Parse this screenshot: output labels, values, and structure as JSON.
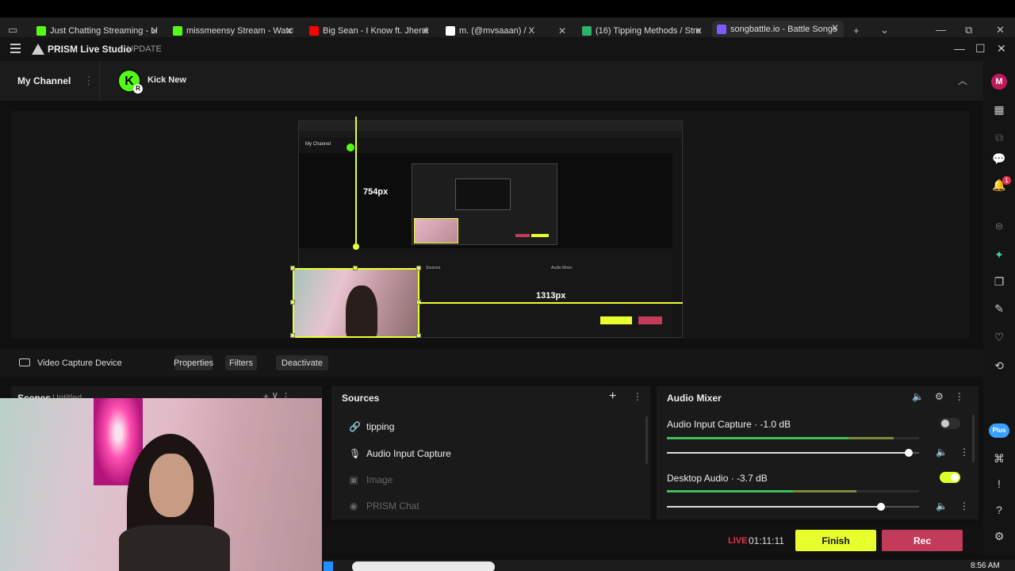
{
  "browser": {
    "tabs": [
      {
        "title": "Just Chatting Streaming - Li",
        "color": "#53fc18"
      },
      {
        "title": "missmeensy Stream - Watch",
        "color": "#53fc18"
      },
      {
        "title": "Big Sean - I Know ft. Jhené A",
        "color": "#ff0000"
      },
      {
        "title": "m. (@mvsaaan) / X",
        "color": "#ffffff"
      },
      {
        "title": "(16) Tipping Methods / Stre",
        "color": "#29b36b"
      },
      {
        "title": "songbattle.io - Battle Songs",
        "color": "#7a5cff"
      }
    ],
    "new_tab": "+",
    "close": "✕"
  },
  "app": {
    "name": "PRISM Live Studio",
    "update_label": "UPDATE",
    "minimize": "—",
    "maximize": "☐",
    "close": "✕"
  },
  "channel": {
    "label": "My Channel",
    "menu": "⋮",
    "kick_letter": "K",
    "kick_badge": "R",
    "kick_name": "Kick New",
    "collapse": "︿"
  },
  "preview": {
    "guide_vertical_label": "754px",
    "guide_horizontal_label": "1313px",
    "mini_channel": "My Channel",
    "mini_sources": "Sources",
    "mini_mixer": "Audio Mixer"
  },
  "source_toolbar": {
    "source_name": "Video Capture Device",
    "properties": "Properties",
    "filters": "Filters",
    "deactivate": "Deactivate"
  },
  "scenes": {
    "title": "Scenes",
    "subtitle": "Untitled ⌄",
    "icons": "+  ⊻  ⋮"
  },
  "sources": {
    "title": "Sources",
    "add": "+",
    "more": "⋮",
    "items": [
      {
        "label": "tipping",
        "icon": "🔗",
        "enabled": true
      },
      {
        "label": "Audio Input Capture",
        "icon": "🎙",
        "enabled": true
      },
      {
        "label": "Image",
        "icon": "▣",
        "enabled": false
      },
      {
        "label": "PRISM Chat",
        "icon": "◉",
        "enabled": false
      }
    ]
  },
  "mixer": {
    "title": "Audio Mixer",
    "header_icons": "🔈⚙⋮",
    "channels": [
      {
        "name": "Audio Input Capture",
        "db": "-1.0 dB",
        "level": 0.72,
        "peak": 0.9,
        "volume": 0.96,
        "active": false
      },
      {
        "name": "Desktop Audio",
        "db": "-3.7 dB",
        "level": 0.5,
        "peak": 0.75,
        "volume": 0.85,
        "active": true
      }
    ],
    "vol_icon": "🔈",
    "more": "⋮"
  },
  "status": {
    "live": "LIVE",
    "timer": "01:11:11",
    "finish": "Finish",
    "rec": "Rec"
  },
  "sidebar": {
    "avatar": "M",
    "notif_count": "1",
    "plus": "Plus"
  },
  "taskbar": {
    "clock": "8:56 AM"
  },
  "colors": {
    "accent": "#e6ff2d",
    "rec": "#c23b5b",
    "live": "#e8334d",
    "kick": "#53fc18"
  }
}
